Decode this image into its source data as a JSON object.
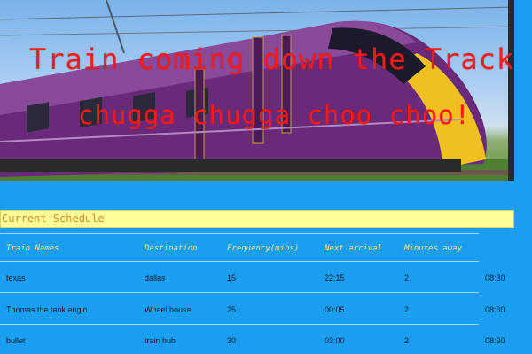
{
  "hero": {
    "headline_line1": "Train coming down the Track!",
    "headline_line2": "chugga chugga choo choo!",
    "image_icon": "train-photo",
    "colors": {
      "headline": "#ff1a1a",
      "train_body": "#6a2a7a",
      "train_nose": "#f0c020"
    }
  },
  "schedule": {
    "title": "Current Schedule",
    "columns": [
      "Train Names",
      "Destination",
      "Frequency(mins)",
      "Next arrival",
      "Minutes away"
    ],
    "rows": [
      {
        "name": "texas",
        "destination": "dallas",
        "frequency": "15",
        "next_arrival": "22:15",
        "minutes_away": "2",
        "extra": "08:30"
      },
      {
        "name": "Thomas the tank engin",
        "destination": "Wheel house",
        "frequency": "25",
        "next_arrival": "00:05",
        "minutes_away": "2",
        "extra": "08:30"
      },
      {
        "name": "bullet",
        "destination": "train hub",
        "frequency": "30",
        "next_arrival": "03:00",
        "minutes_away": "2",
        "extra": "08:30"
      }
    ]
  },
  "colors": {
    "page_background": "#1a9ff0",
    "schedule_bar": "#ffff99",
    "header_text": "#f6e27a"
  }
}
